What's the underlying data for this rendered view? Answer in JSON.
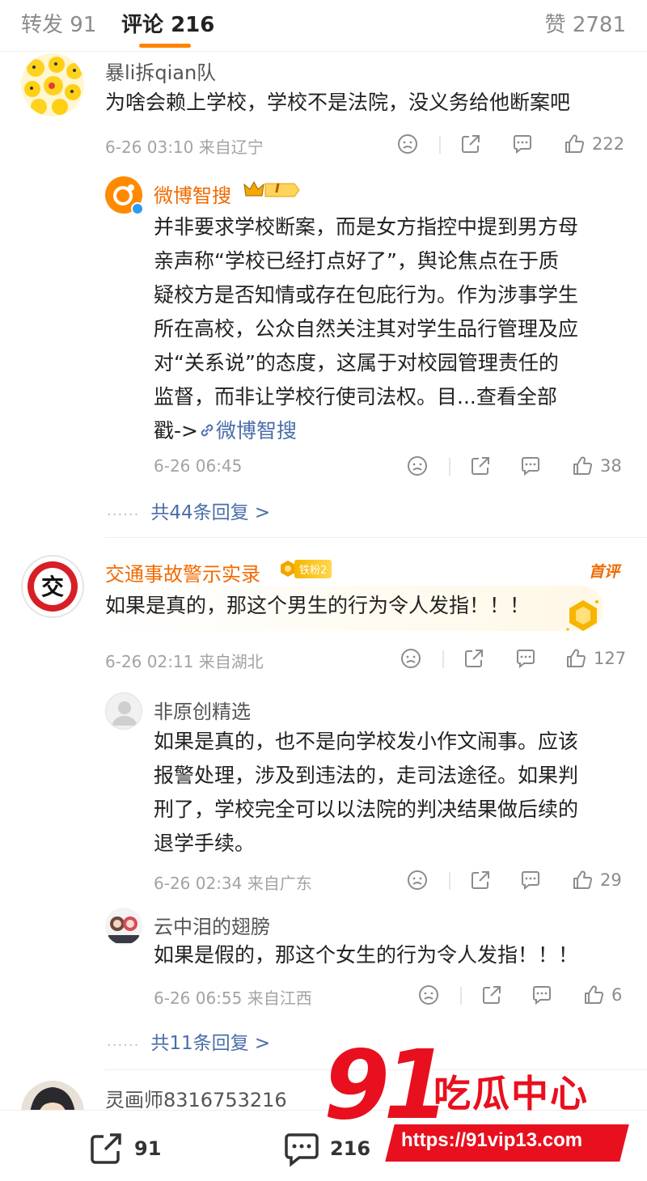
{
  "tabs": {
    "repost_label": "转发",
    "repost_count": "91",
    "comment_label": "评论",
    "comment_count": "216",
    "like_label": "赞",
    "like_count": "2781"
  },
  "comments": [
    {
      "username": "暴li拆qian队",
      "text": "为啥会赖上学校，学校不是法院，没义务给他断案吧",
      "time": "6-26 03:10",
      "location": "来自辽宁",
      "likes": "222"
    },
    {
      "username": "交通事故警示实录",
      "badge": "铁粉2",
      "first_tag": "首评",
      "avatar_char": "交",
      "text": "如果是真的，那这个男生的行为令人发指！！！",
      "time": "6-26 02:11",
      "location": "来自湖北",
      "likes": "127"
    },
    {
      "username": "灵画师8316753216"
    }
  ],
  "replies": [
    {
      "username": "微博智搜",
      "level": "I",
      "text_lines": [
        "并非要求学校断案，而是女方指控中提到男方母",
        "亲声称“学校已经打点好了”，舆论焦点在于质",
        "疑校方是否知情或存在包庇行为。作为涉事学生",
        "所在高校，公众自然关注其对学生品行管理及应",
        "对“关系说”的态度，这属于对校园管理责任的",
        "监督，而非让学校行使司法权。目...查看全部"
      ],
      "text_tail": "戳->",
      "link_text": "微博智搜",
      "time": "6-26 06:45",
      "likes": "38"
    },
    {
      "username": "非原创精选",
      "text_lines": [
        "如果是真的，也不是向学校发小作文闹事。应该",
        "报警处理，涉及到违法的，走司法途径。如果判",
        "刑了，学校完全可以以法院的判决结果做后续的",
        "退学手续。"
      ],
      "time": "6-26 02:34",
      "location": "来自广东",
      "likes": "29"
    },
    {
      "username": "云中泪的翅膀",
      "text": "如果是假的，那这个女生的行为令人发指！！！",
      "time": "6-26 06:55",
      "location": "来自江西",
      "likes": "6"
    }
  ],
  "more_replies": [
    {
      "dots": "......",
      "label": "共44条回复 >"
    },
    {
      "dots": "......",
      "label": "共11条回复 >"
    }
  ],
  "bottom_bar": {
    "repost_count": "91",
    "comment_count": "216"
  },
  "watermark": {
    "number": "91",
    "title": "吃瓜中心",
    "url": "https://91vip13.com"
  },
  "colors": {
    "accent": "#ff8200",
    "link": "#4a6ea8",
    "orange_name": "#f26a00",
    "watermark_red": "#e8101e"
  }
}
